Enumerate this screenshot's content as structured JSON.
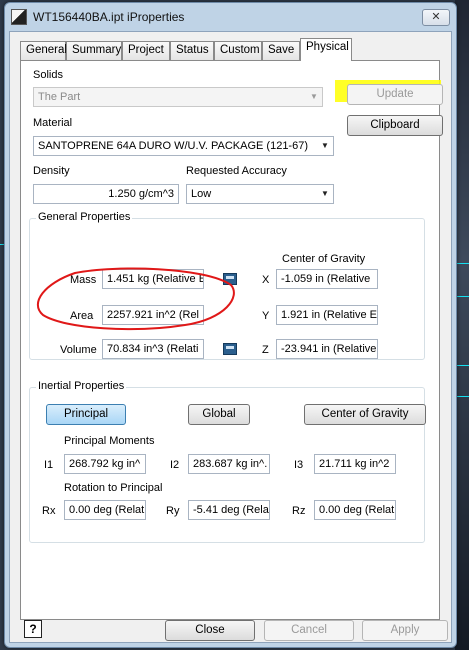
{
  "window": {
    "title": "WT156440BA.ipt iProperties",
    "close_glyph": "✕"
  },
  "tabs": [
    "General",
    "Summary",
    "Project",
    "Status",
    "Custom",
    "Save",
    "Physical"
  ],
  "active_tab": "Physical",
  "solids": {
    "label": "Solids",
    "value": "The Part",
    "update_label": "Update",
    "clipboard_label": "Clipboard"
  },
  "material": {
    "label": "Material",
    "value": "SANTOPRENE 64A DURO W/U.V. PACKAGE (121-67)"
  },
  "density": {
    "label": "Density",
    "value": "1.250 g/cm^3"
  },
  "accuracy": {
    "label": "Requested Accuracy",
    "value": "Low"
  },
  "general_properties": {
    "title": "General Properties",
    "mass_label": "Mass",
    "mass_value": "1.451 kg (Relative E",
    "area_label": "Area",
    "area_value": "2257.921 in^2 (Rel",
    "volume_label": "Volume",
    "volume_value": "70.834 in^3 (Relati",
    "cog_title": "Center of Gravity",
    "x_label": "X",
    "x_value": "-1.059 in (Relative",
    "y_label": "Y",
    "y_value": "1.921 in (Relative E",
    "z_label": "Z",
    "z_value": "-23.941 in (Relative"
  },
  "inertial_properties": {
    "title": "Inertial Properties",
    "principal_label": "Principal",
    "global_label": "Global",
    "cog_label": "Center of Gravity",
    "moments_title": "Principal Moments",
    "i1_label": "I1",
    "i1_value": "268.792 kg in^",
    "i2_label": "I2",
    "i2_value": "283.687 kg in^.",
    "i3_label": "I3",
    "i3_value": "21.711 kg in^2",
    "rotation_title": "Rotation to Principal",
    "rx_label": "Rx",
    "rx_value": "0.00 deg (Relat",
    "ry_label": "Ry",
    "ry_value": "-5.41 deg (Rela",
    "rz_label": "Rz",
    "rz_value": "0.00 deg (Relat"
  },
  "footer": {
    "help_label": "?",
    "close_label": "Close",
    "cancel_label": "Cancel",
    "apply_label": "Apply"
  },
  "colors": {
    "highlight": "#ffff00",
    "annotation_circle": "#e01818",
    "pressed_button": "#a9d6f6"
  }
}
